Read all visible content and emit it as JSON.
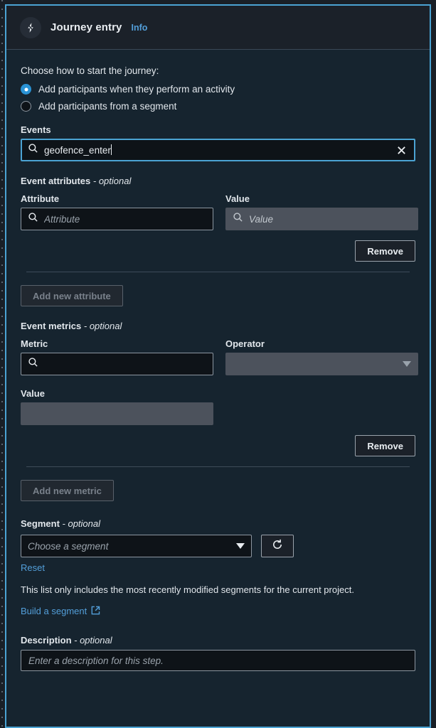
{
  "panel": {
    "icon": "lightning-bolt-icon",
    "title": "Journey entry",
    "info_label": "Info"
  },
  "entry": {
    "prompt": "Choose how to start the journey:",
    "options": [
      {
        "label": "Add participants when they perform an activity",
        "selected": true
      },
      {
        "label": "Add participants from a segment",
        "selected": false
      }
    ]
  },
  "events": {
    "label": "Events",
    "value": "geofence_enter",
    "search_icon": "search-icon",
    "clear_icon": "close-icon"
  },
  "event_attributes": {
    "group_label": "Event attributes",
    "optional_suffix": "- optional",
    "attribute": {
      "label": "Attribute",
      "placeholder": "Attribute",
      "value": ""
    },
    "value_field": {
      "label": "Value",
      "placeholder": "Value",
      "value": "",
      "disabled": true
    },
    "remove_label": "Remove",
    "add_label": "Add new attribute",
    "add_disabled": true
  },
  "event_metrics": {
    "group_label": "Event metrics",
    "optional_suffix": "- optional",
    "metric": {
      "label": "Metric",
      "placeholder": "",
      "value": ""
    },
    "operator": {
      "label": "Operator",
      "selected": "",
      "disabled": true
    },
    "value_field": {
      "label": "Value",
      "value": "",
      "disabled": true
    },
    "remove_label": "Remove",
    "add_label": "Add new metric",
    "add_disabled": true
  },
  "segment": {
    "group_label": "Segment",
    "optional_suffix": "- optional",
    "select_placeholder": "Choose a segment",
    "refresh_icon": "refresh-icon",
    "reset_label": "Reset",
    "helper_text": "This list only includes the most recently modified segments for the current project.",
    "build_label": "Build a segment",
    "external_icon": "external-link-icon"
  },
  "description": {
    "group_label": "Description",
    "optional_suffix": "- optional",
    "placeholder": "Enter a description for this step."
  },
  "colors": {
    "accent": "#4ba3d3",
    "link": "#539fda",
    "panel_bg": "#16242f",
    "header_bg": "#1b2129",
    "input_bg": "#0e1318",
    "disabled_bg": "#4c525c"
  }
}
